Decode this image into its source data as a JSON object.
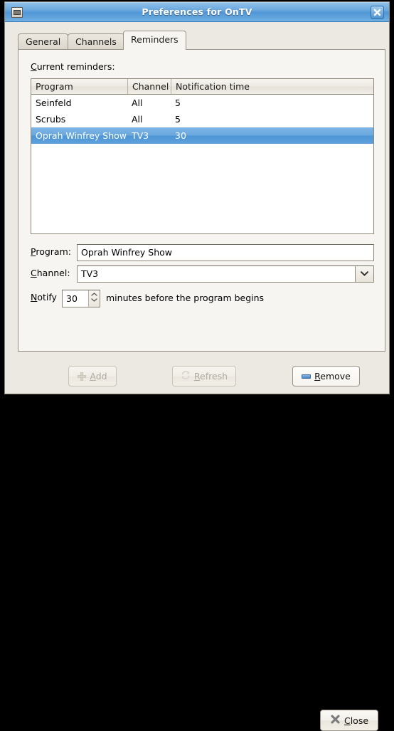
{
  "window": {
    "title": "Preferences for OnTV",
    "icon": "window-menu-icon",
    "close_icon": "close-icon"
  },
  "tabs": [
    {
      "label": "General",
      "active": false
    },
    {
      "label": "Channels",
      "active": false
    },
    {
      "label": "Reminders",
      "active": true
    }
  ],
  "reminders_panel": {
    "section_label": "Current reminders:",
    "table": {
      "columns": [
        "Program",
        "Channel",
        "Notification time"
      ],
      "rows": [
        {
          "program": "Seinfeld",
          "channel": "All",
          "time": "5",
          "selected": false
        },
        {
          "program": "Scrubs",
          "channel": "All",
          "time": "5",
          "selected": false
        },
        {
          "program": "Oprah Winfrey Show",
          "channel": "TV3",
          "time": "30",
          "selected": true
        }
      ]
    },
    "form": {
      "program_label": "Program:",
      "program_value": "Oprah Winfrey Show",
      "channel_label": "Channel:",
      "channel_value": "TV3",
      "notify_label": "Notify",
      "notify_value": "30",
      "notify_suffix": "minutes before the program begins"
    },
    "buttons": {
      "add": "Add",
      "refresh": "Refresh",
      "remove": "Remove"
    }
  },
  "dialog_buttons": {
    "close": "Close"
  },
  "colors": {
    "titlebar_blue": "#67a6dd",
    "selection_blue": "#5ea0da",
    "window_bg": "#ece9e3",
    "panel_bg": "#f7f5f1",
    "border": "#8d8878",
    "remove_icon_blue": "#4a86c6"
  }
}
